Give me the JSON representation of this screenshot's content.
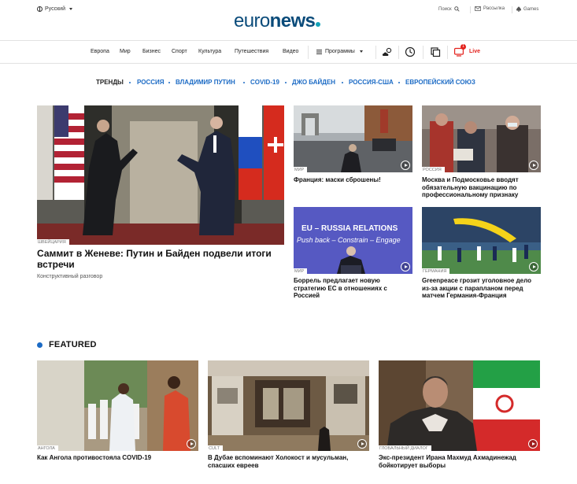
{
  "header": {
    "language": "Русский",
    "logo_light": "euro",
    "logo_bold": "news",
    "search_label": "Поиск",
    "newsletters_label": "Рассылка",
    "games_label": "Games"
  },
  "nav": {
    "items": [
      "Европа",
      "Мир",
      "Бизнес",
      "Спорт",
      "Культура",
      "Путешествия",
      "Видео"
    ],
    "programs_label": "Программы",
    "live_label": "Live",
    "live_badge": "1"
  },
  "trends": {
    "heading": "ТРЕНДЫ",
    "items": [
      "РОССИЯ",
      "ВЛАДИМИР ПУТИН",
      "COVID-19",
      "ДЖО БАЙДЕН",
      "РОССИЯ-США",
      "ЕВРОПЕЙСКИЙ СОЮЗ"
    ]
  },
  "top_story": {
    "tag": "ШВЕЙЦАРИЯ",
    "title": "Саммит в Женеве: Путин и Байден подвели итоги встречи",
    "subtitle": "Конструктивный разговор"
  },
  "stories": [
    {
      "tag": "МИР",
      "title": "Франция: маски сброшены!"
    },
    {
      "tag": "РОССИЯ",
      "title": "Москва и Подмосковье вводят обязательную вакцинацию по профессиональному признаку"
    },
    {
      "tag": "МИР",
      "title": "Боррель предлагает новую стратегию ЕС в отношениях с Россией",
      "banner_1": "EU – RUSSIA RELATIONS",
      "banner_2": "Push back – Constrain – Engage"
    },
    {
      "tag": "ГЕРМАНИЯ",
      "title": "Greenpeace грозит уголовное дело из-за акции с парапланом перед матчем Германия-Франция"
    }
  ],
  "featured": {
    "heading": "FEATURED",
    "items": [
      {
        "tag": "АНГОЛА",
        "title": "Как Ангола противостояла COVID-19"
      },
      {
        "tag": "CULT",
        "title": "В Дубае вспоминают Холокост и мусульман, спасших евреев"
      },
      {
        "tag": "ГЛОБАЛЬНЫЙ ДИАЛОГ",
        "title": "Экс-президент Ирана Махмуд Ахмадинежад бойкотирует выборы"
      }
    ]
  },
  "colors": {
    "brand": "#0a4b7a",
    "accent": "#1c6bc5",
    "live": "#e3211c"
  }
}
